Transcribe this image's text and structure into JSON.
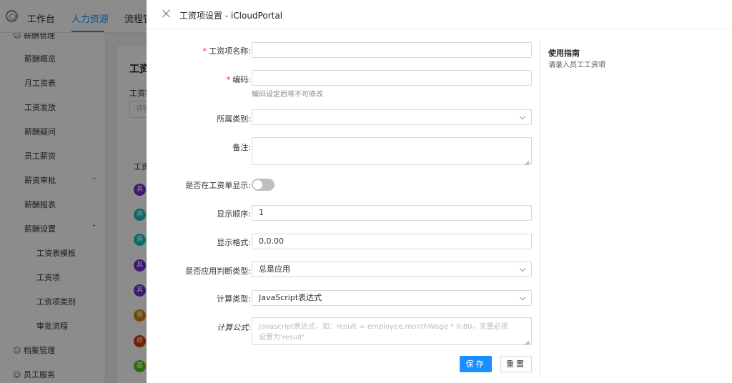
{
  "app": {
    "nav": [
      "工作台",
      "人力资源",
      "流程管"
    ],
    "sidebar": {
      "groups": [
        "薪酬管理",
        "档案管理",
        "员工服务"
      ],
      "items": [
        "薪酬概览",
        "月工资表",
        "工资发放",
        "薪酬疑问",
        "员工薪资",
        "薪资审批",
        "薪酬报表",
        "薪酬设置"
      ],
      "sub_items": [
        "工资表模板",
        "工资项",
        "工资项类别",
        "审批流程"
      ]
    },
    "card": {
      "title": "工资",
      "label": "工资项",
      "input_placeholder": "请输",
      "column": "工资",
      "avatars": [
        {
          "text": "其",
          "color": "#722ed1"
        },
        {
          "text": "病",
          "color": "#13c2c2"
        },
        {
          "text": "病",
          "color": "#13c2c2"
        },
        {
          "text": "其",
          "color": "#722ed1"
        },
        {
          "text": "其",
          "color": "#722ed1"
        },
        {
          "text": "餐",
          "color": "#d48806"
        },
        {
          "text": "绩",
          "color": "#d4380d"
        },
        {
          "text": "基",
          "color": "#52c41a"
        }
      ]
    }
  },
  "drawer": {
    "title": "工资项设置 - iCloudPortal",
    "fields": {
      "name_label": "工资项名称:",
      "code_label": "编码:",
      "code_help": "编码设定后将不可修改",
      "category_label": "所属类别:",
      "remark_label": "备注:",
      "show_label": "是否在工资单显示:",
      "order_label": "显示顺序:",
      "order_value": "1",
      "format_label": "显示格式:",
      "format_value": "0,0.00",
      "judge_label": "是否应用判断类型:",
      "judge_value": "总是应用",
      "calc_type_label": "计算类型:",
      "calc_type_value": "JavaScript表达式",
      "formula_label": "计算公式:",
      "formula_placeholder": "Javascript表达式，如：result = employee.monthWage * 0.80，变量必须设置为'result'"
    },
    "buttons": {
      "save": "保存",
      "reset": "重置"
    },
    "guide": {
      "title": "使用指南",
      "text": "请录入员工工资项"
    }
  }
}
